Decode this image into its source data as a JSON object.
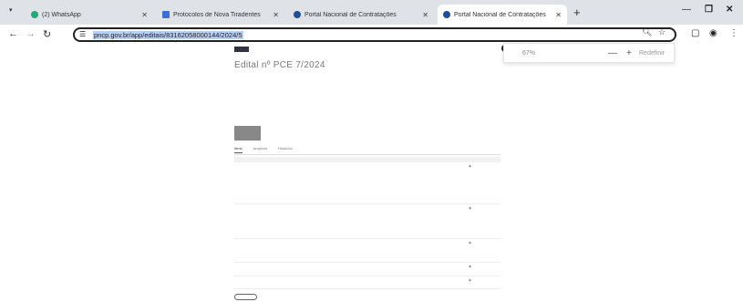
{
  "browser": {
    "tabs": [
      {
        "title": "(2) WhatsApp",
        "active": false
      },
      {
        "title": "Protocolos de Nova Tiradentes",
        "active": false
      },
      {
        "title": "Portal Nacional de Contratações",
        "active": false
      },
      {
        "title": "Portal Nacional de Contratações",
        "active": true
      }
    ],
    "url": "pncp.gov.br/app/editais/83162058000144/2024/5"
  },
  "zoom": {
    "percent": "67%",
    "minus": "—",
    "plus": "+",
    "reset": "Redefinir"
  },
  "page": {
    "title": "Edital nº PCE 7/2024"
  },
  "tabs": [
    "Itens",
    "Arquivos",
    "Histórico"
  ],
  "colors": {
    "accent": "#1f4e96",
    "omnibox_highlight": "#b8cff4"
  }
}
